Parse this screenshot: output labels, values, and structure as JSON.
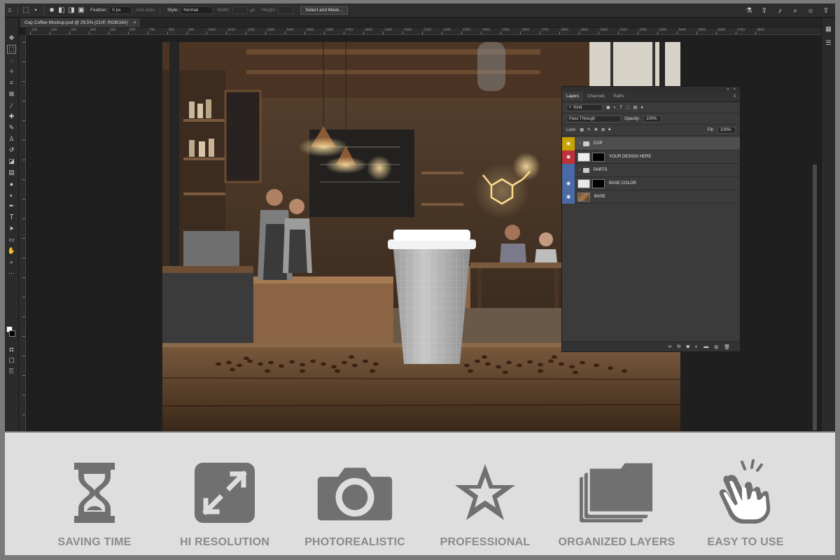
{
  "options_bar": {
    "feather_label": "Feather:",
    "feather_value": "0 px",
    "antialias_label": "Anti-alias",
    "style_label": "Style:",
    "style_value": "Normal",
    "width_label": "Width:",
    "height_label": "Height:",
    "select_mask_button": "Select and Mask..."
  },
  "document_tab": {
    "title": "Cup Coffee Mockup.psd @ 29,5% (CUP, RGB/16#)",
    "close": "×"
  },
  "ruler": {
    "labels": [
      "100",
      "200",
      "300",
      "400",
      "500",
      "600",
      "700",
      "800",
      "900",
      "1000",
      "1100",
      "1200",
      "1300",
      "1400",
      "1500",
      "1600",
      "1700",
      "1800",
      "1900",
      "2000",
      "2100",
      "2200",
      "2300",
      "2400",
      "2500",
      "2600",
      "2700",
      "2800",
      "2900",
      "3000",
      "3100",
      "3200",
      "3300",
      "3400",
      "3500",
      "3600",
      "3700",
      "3800"
    ]
  },
  "layers_panel": {
    "tabs": [
      "Layers",
      "Channels",
      "Paths"
    ],
    "filter_label": "Kind",
    "blend_mode": "Pass Through",
    "opacity_label": "Opacity:",
    "opacity_value": "100%",
    "lock_label": "Lock:",
    "fill_label": "Fill:",
    "fill_value": "100%",
    "layers": [
      {
        "name": "CUP",
        "color": "#c9a400",
        "type": "group"
      },
      {
        "name": "YOUR DESIGN HERE",
        "color": "#c0303a",
        "type": "smart"
      },
      {
        "name": "PARTS",
        "color": "#4a6aa6",
        "type": "group"
      },
      {
        "name": "BASE COLOR",
        "color": "#4a6aa6",
        "type": "fill"
      },
      {
        "name": "BASE",
        "color": "#4a6aa6",
        "type": "image"
      }
    ],
    "bottom_icons": [
      "link-icon",
      "fx-icon",
      "mask-icon",
      "adjustment-icon",
      "folder-icon",
      "new-layer-icon",
      "trash-icon"
    ],
    "bottom_fx": "fx"
  },
  "features": [
    {
      "label": "SAVING TIME",
      "icon": "hourglass-icon"
    },
    {
      "label": "HI RESOLUTION",
      "icon": "expand-arrows-icon"
    },
    {
      "label": "PHOTOREALISTIC",
      "icon": "camera-icon"
    },
    {
      "label": "PROFESSIONAL",
      "icon": "star-icon"
    },
    {
      "label": "ORGANIZED LAYERS",
      "icon": "stacked-folders-icon"
    },
    {
      "label": "EASY TO USE",
      "icon": "tap-hand-icon"
    }
  ],
  "colors": {
    "feature_icon": "#707070",
    "feature_text": "#8a8a8a",
    "features_bg": "#dedede"
  }
}
